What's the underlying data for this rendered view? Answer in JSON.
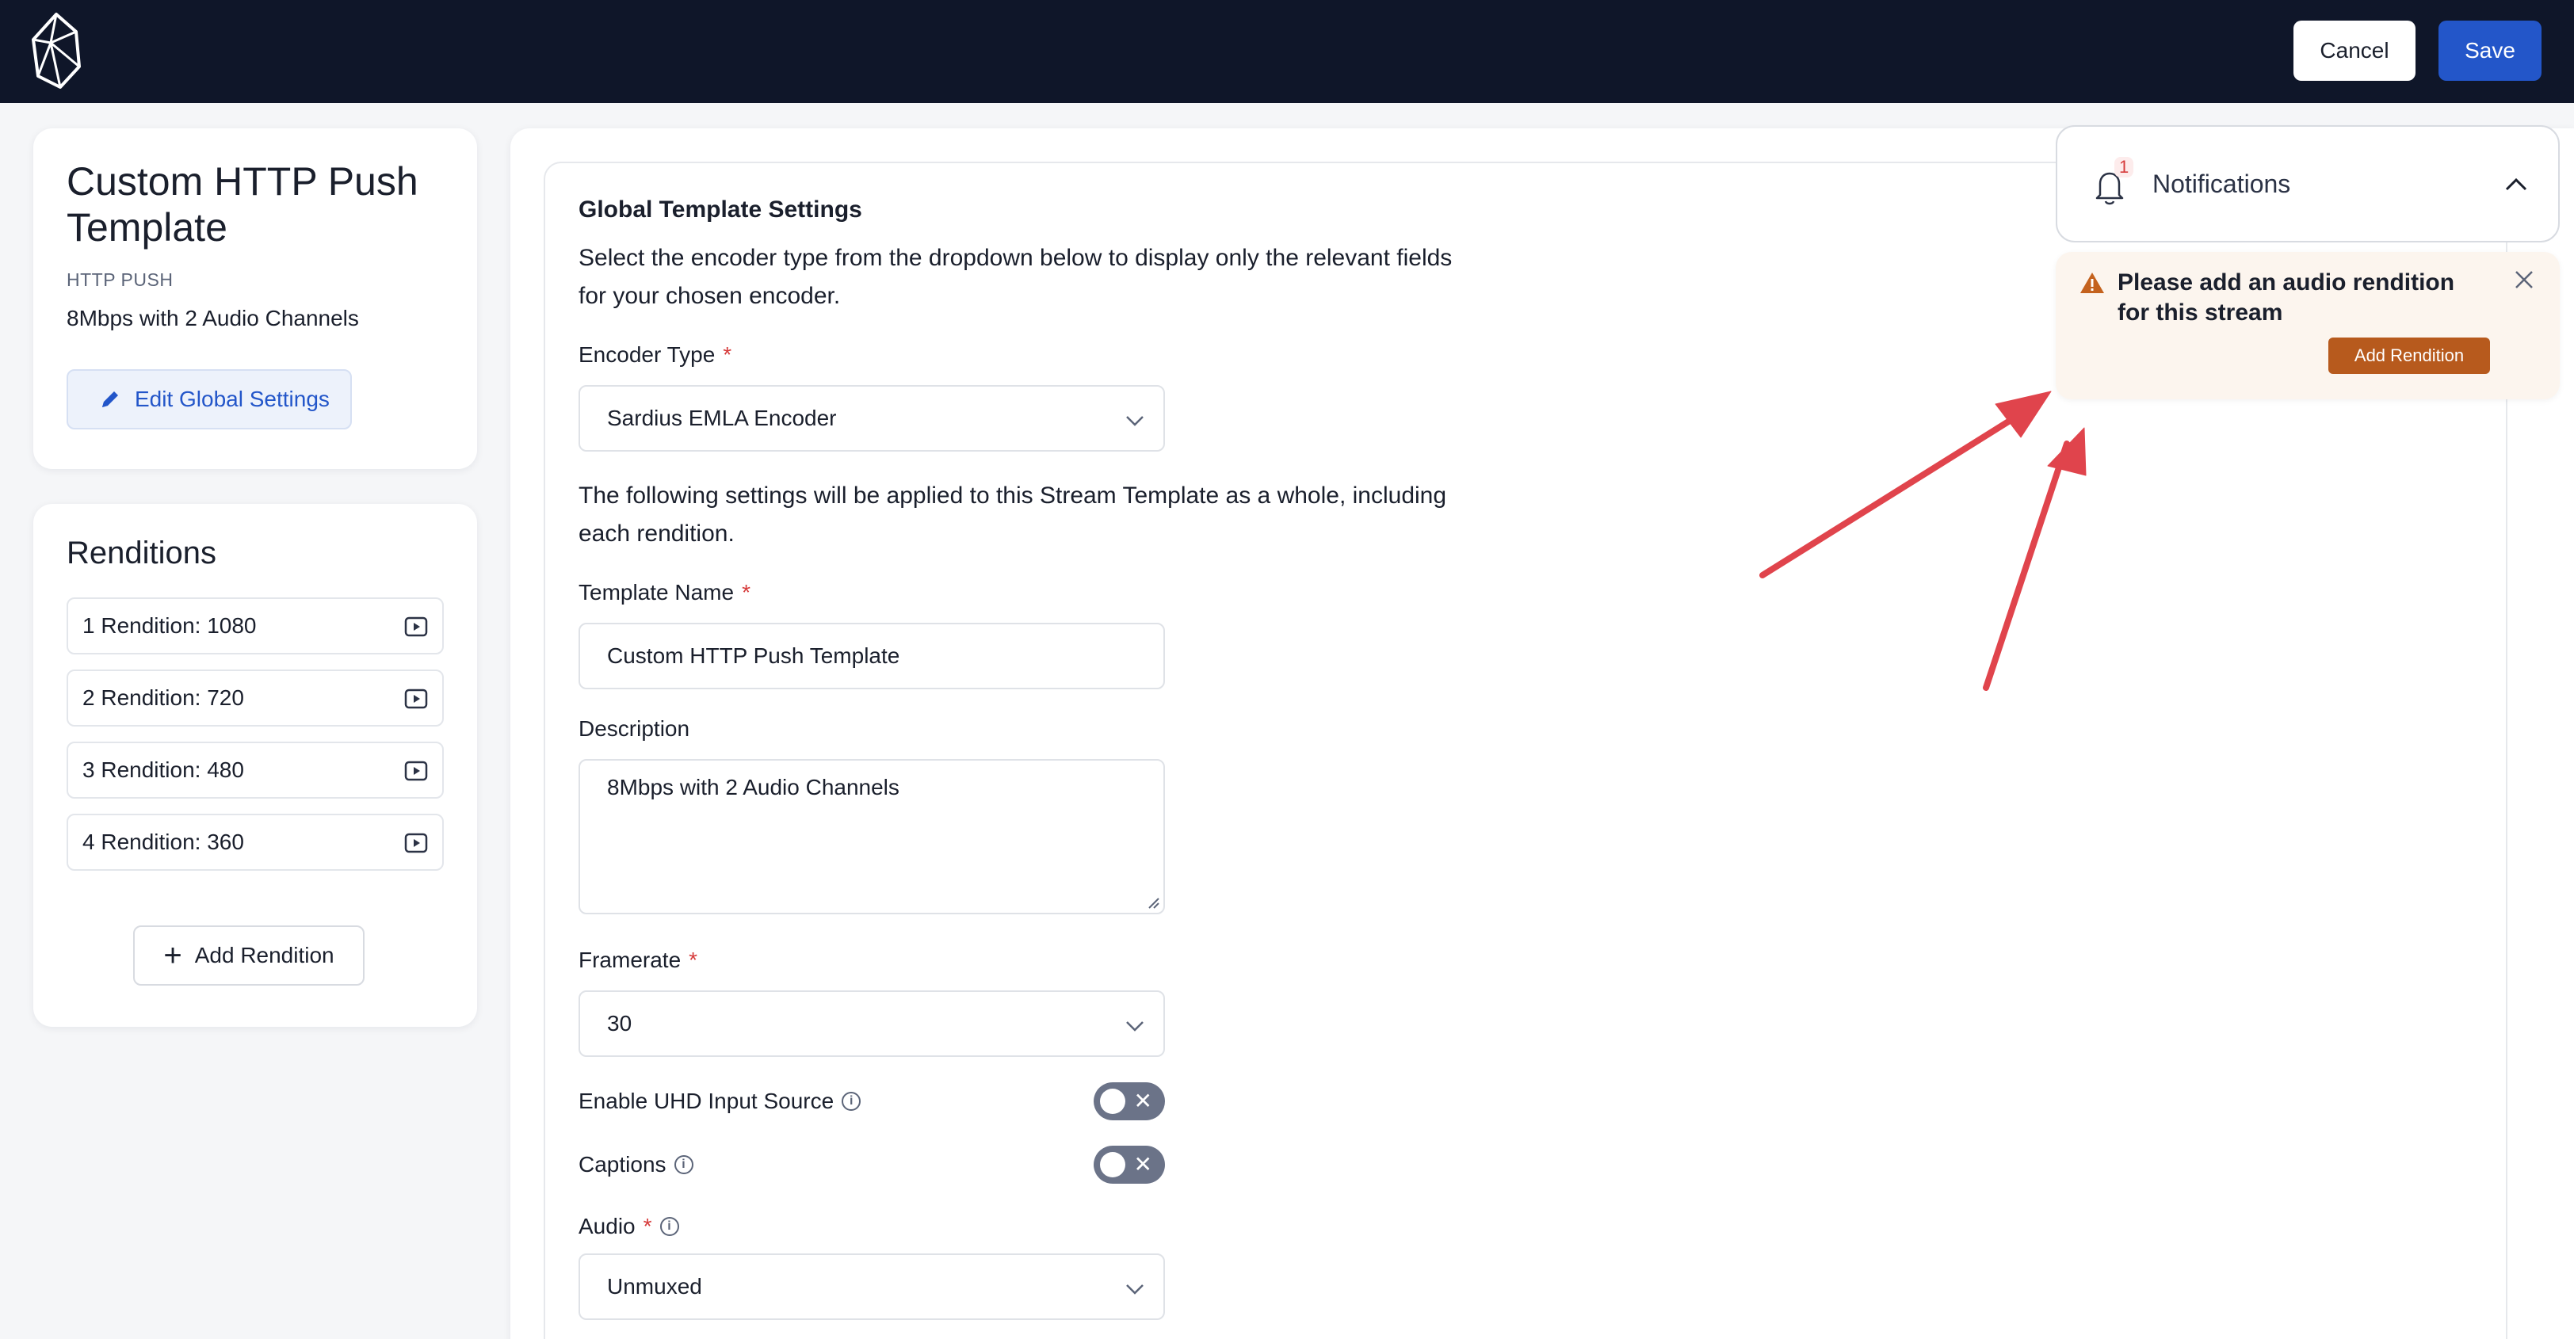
{
  "header": {
    "cancel_label": "Cancel",
    "save_label": "Save"
  },
  "template": {
    "title": "Custom HTTP Push Template",
    "kind": "HTTP PUSH",
    "description": "8Mbps with 2 Audio Channels",
    "edit_label": "Edit Global Settings"
  },
  "renditions": {
    "title": "Renditions",
    "items": [
      {
        "label": "1 Rendition: 1080"
      },
      {
        "label": "2 Rendition: 720"
      },
      {
        "label": "3 Rendition: 480"
      },
      {
        "label": "4 Rendition: 360"
      }
    ],
    "add_label": "Add Rendition"
  },
  "form": {
    "section_title": "Global Template Settings",
    "intro": "Select the encoder type from the dropdown below to display only the relevant fields for your chosen encoder.",
    "encoder_type_label": "Encoder Type",
    "encoder_type_value": "Sardius EMLA Encoder",
    "applied_note": "The following settings will be applied to this Stream Template as a whole, including each rendition.",
    "template_name_label": "Template Name",
    "template_name_value": "Custom HTTP Push Template",
    "description_label": "Description",
    "description_value": "8Mbps with 2 Audio Channels",
    "framerate_label": "Framerate",
    "framerate_value": "30",
    "uhd_label": "Enable UHD Input Source",
    "captions_label": "Captions",
    "audio_label": "Audio",
    "audio_value": "Unmuxed",
    "required_mark": "*",
    "info_glyph": "i",
    "toggle_off_glyph": "✕"
  },
  "notifications": {
    "title": "Notifications",
    "count": "1",
    "alert_message": "Please add an audio rendition for this stream",
    "alert_button": "Add Rendition"
  },
  "colors": {
    "header_bg": "#0f1629",
    "primary": "#2356c9",
    "warning": "#b75a1d",
    "annotation_arrow": "#e0444c"
  }
}
